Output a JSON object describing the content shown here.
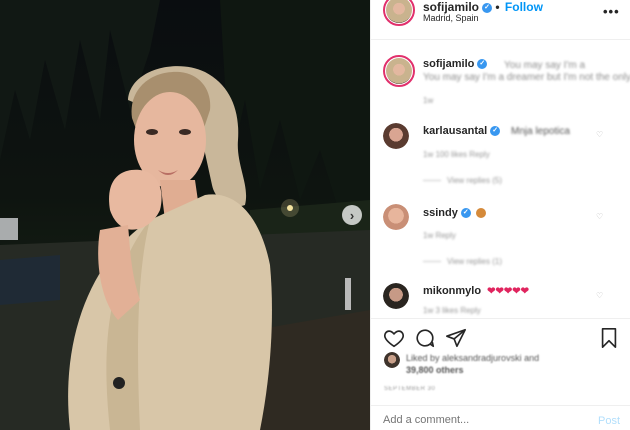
{
  "post": {
    "username": "sofijamilo",
    "follow_label": "Follow",
    "location": "Madrid, Spain",
    "more_icon": "more-dots-icon",
    "caption": "You may say I'm a dreamer but I'm not the only one",
    "caption_age": "1w"
  },
  "comments": [
    {
      "username": "karlausantal",
      "text": "Mnja lepotica",
      "meta": "1w   100 likes   Reply",
      "replies": "View replies (5)"
    },
    {
      "username": "ssindy",
      "text": "",
      "meta": "1w   Reply",
      "replies": "View replies (1)"
    },
    {
      "username": "mikonmylo",
      "text": "❤❤❤❤❤",
      "meta": "1w   3 likes   Reply",
      "replies": ""
    }
  ],
  "actions": {
    "like_icon": "heart-icon",
    "comment_icon": "comment-icon",
    "share_icon": "share-icon",
    "save_icon": "bookmark-icon"
  },
  "likes": {
    "line1": "Liked by aleksandradjurovski and",
    "line2": "39,800 others"
  },
  "date": "SEPTEMBER 30",
  "add_comment": {
    "placeholder": "Add a comment...",
    "post_label": "Post"
  },
  "colors": {
    "accent": "#0095f6",
    "ring": "#e1306c",
    "verified": "#3897f0"
  }
}
